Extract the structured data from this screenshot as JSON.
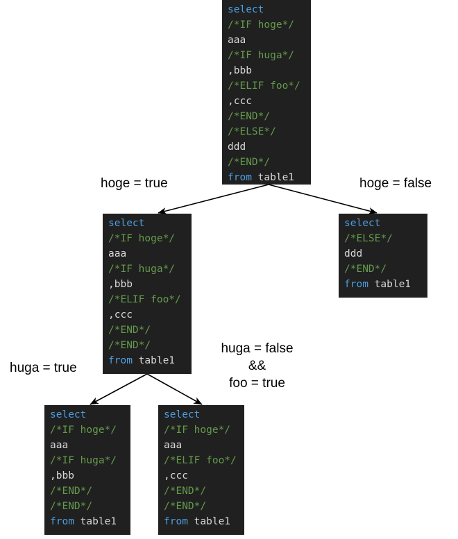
{
  "diagram": {
    "title": "SQL two-way SQL conditional comment branch expansion",
    "background_color": "#ffffff",
    "code_block_background": "#202020",
    "keyword_color": "#4d9ee0",
    "comment_color": "#649a4c",
    "identifier_color": "#d8d8d8",
    "arrow_color": "#000000"
  },
  "nodes": [
    {
      "id": "root",
      "name": "root-sql-block",
      "lines": [
        [
          {
            "t": "select",
            "c": "kw"
          }
        ],
        [
          {
            "t": "/*IF hoge*/",
            "c": "cm"
          }
        ],
        [
          {
            "t": "aaa",
            "c": "id"
          }
        ],
        [
          {
            "t": "/*IF huga*/",
            "c": "cm"
          }
        ],
        [
          {
            "t": ",bbb",
            "c": "id"
          }
        ],
        [
          {
            "t": "/*ELIF foo*/",
            "c": "cm"
          }
        ],
        [
          {
            "t": ",ccc",
            "c": "id"
          }
        ],
        [
          {
            "t": "/*END*/",
            "c": "cm"
          }
        ],
        [
          {
            "t": "/*ELSE*/",
            "c": "cm"
          }
        ],
        [
          {
            "t": "ddd",
            "c": "id"
          }
        ],
        [
          {
            "t": "/*END*/",
            "c": "cm"
          }
        ],
        [
          {
            "t": "from ",
            "c": "kw"
          },
          {
            "t": "table1",
            "c": "id"
          }
        ]
      ]
    },
    {
      "id": "hoge-true",
      "name": "hoge-true-sql-block",
      "lines": [
        [
          {
            "t": "select",
            "c": "kw"
          }
        ],
        [
          {
            "t": "/*IF hoge*/",
            "c": "cm"
          }
        ],
        [
          {
            "t": "aaa",
            "c": "id"
          }
        ],
        [
          {
            "t": "/*IF huga*/",
            "c": "cm"
          }
        ],
        [
          {
            "t": ",bbb",
            "c": "id"
          }
        ],
        [
          {
            "t": "/*ELIF foo*/",
            "c": "cm"
          }
        ],
        [
          {
            "t": ",ccc",
            "c": "id"
          }
        ],
        [
          {
            "t": "/*END*/",
            "c": "cm"
          }
        ],
        [
          {
            "t": "/*END*/",
            "c": "cm"
          }
        ],
        [
          {
            "t": "from ",
            "c": "kw"
          },
          {
            "t": "table1",
            "c": "id"
          }
        ]
      ]
    },
    {
      "id": "hoge-false",
      "name": "hoge-false-sql-block",
      "lines": [
        [
          {
            "t": "select",
            "c": "kw"
          }
        ],
        [
          {
            "t": "/*ELSE*/",
            "c": "cm"
          }
        ],
        [
          {
            "t": "ddd",
            "c": "id"
          }
        ],
        [
          {
            "t": "/*END*/",
            "c": "cm"
          }
        ],
        [
          {
            "t": "from ",
            "c": "kw"
          },
          {
            "t": "table1",
            "c": "id"
          }
        ]
      ]
    },
    {
      "id": "huga-true",
      "name": "huga-true-sql-block",
      "lines": [
        [
          {
            "t": "select",
            "c": "kw"
          }
        ],
        [
          {
            "t": "/*IF hoge*/",
            "c": "cm"
          }
        ],
        [
          {
            "t": "aaa",
            "c": "id"
          }
        ],
        [
          {
            "t": "/*IF huga*/",
            "c": "cm"
          }
        ],
        [
          {
            "t": ",bbb",
            "c": "id"
          }
        ],
        [
          {
            "t": "/*END*/",
            "c": "cm"
          }
        ],
        [
          {
            "t": "/*END*/",
            "c": "cm"
          }
        ],
        [
          {
            "t": "from ",
            "c": "kw"
          },
          {
            "t": "table1",
            "c": "id"
          }
        ]
      ]
    },
    {
      "id": "foo-true",
      "name": "foo-true-sql-block",
      "lines": [
        [
          {
            "t": "select",
            "c": "kw"
          }
        ],
        [
          {
            "t": "/*IF hoge*/",
            "c": "cm"
          }
        ],
        [
          {
            "t": "aaa",
            "c": "id"
          }
        ],
        [
          {
            "t": "/*ELIF foo*/",
            "c": "cm"
          }
        ],
        [
          {
            "t": ",ccc",
            "c": "id"
          }
        ],
        [
          {
            "t": "/*END*/",
            "c": "cm"
          }
        ],
        [
          {
            "t": "/*END*/",
            "c": "cm"
          }
        ],
        [
          {
            "t": "from ",
            "c": "kw"
          },
          {
            "t": "table1",
            "c": "id"
          }
        ]
      ]
    }
  ],
  "edge_labels": {
    "hoge_true": "hoge = true",
    "hoge_false": "hoge = false",
    "huga_true": "huga = true",
    "huga_false_foo_true": "huga = false\n&&\nfoo = true"
  }
}
